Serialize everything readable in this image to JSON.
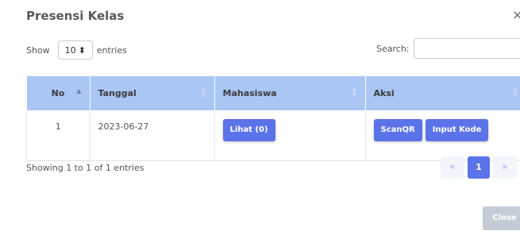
{
  "modal": {
    "title": "Presensi Kelas",
    "close_icon": "close-icon",
    "close_glyph": "×",
    "close_button_label": "Close"
  },
  "length_menu": {
    "prefix": "Show",
    "value": "10",
    "arrows": "⬍",
    "suffix": "entries"
  },
  "search": {
    "label": "Search:",
    "value": ""
  },
  "table": {
    "columns": [
      "No",
      "Tanggal",
      "Mahasiswa",
      "Aksi"
    ],
    "sort": {
      "active_column": "No",
      "direction": "ascending"
    },
    "sort_glyphs": {
      "up": "▲",
      "both_up": "▲",
      "both_down": "▼"
    },
    "rows": [
      {
        "no": "1",
        "tanggal": "2023-06-27",
        "mahasiswa_button": "Lihat (0)",
        "aksi_buttons": [
          "ScanQR",
          "Input Kode"
        ]
      }
    ]
  },
  "info": "Showing 1 to 1 of 1 entries",
  "pagination": {
    "prev_glyph": "«",
    "current_page": "1",
    "next_glyph": "»"
  },
  "colors": {
    "header_bg": "#a9c6f5",
    "primary_button": "#5b73e8",
    "close_button": "#c5ccd6"
  }
}
